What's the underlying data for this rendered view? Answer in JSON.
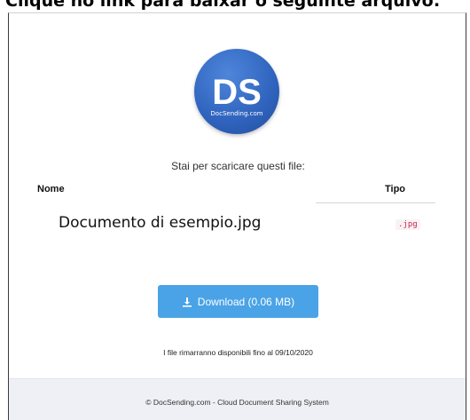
{
  "header": {
    "caption": "Clique no link para baixar o seguinte arquivo:"
  },
  "logo": {
    "letters": "DS",
    "site": "DocSending.com"
  },
  "main": {
    "intro": "Stai per scaricare questi file:",
    "columns": {
      "name": "Nome",
      "type": "Tipo"
    },
    "files": [
      {
        "name": "Documento di esempio.jpg",
        "type": ".jpg"
      }
    ],
    "download_label": "Download (0.06 MB)",
    "expiry": "I file rimarranno disponibili fino al 09/10/2020"
  },
  "footer": {
    "text": "© DocSending.com - Cloud Document Sharing System"
  },
  "colors": {
    "accent": "#4aa3e6",
    "logo": "#2f63bd",
    "type_badge": "#c7254e",
    "footer_bg": "#eef0f5"
  }
}
